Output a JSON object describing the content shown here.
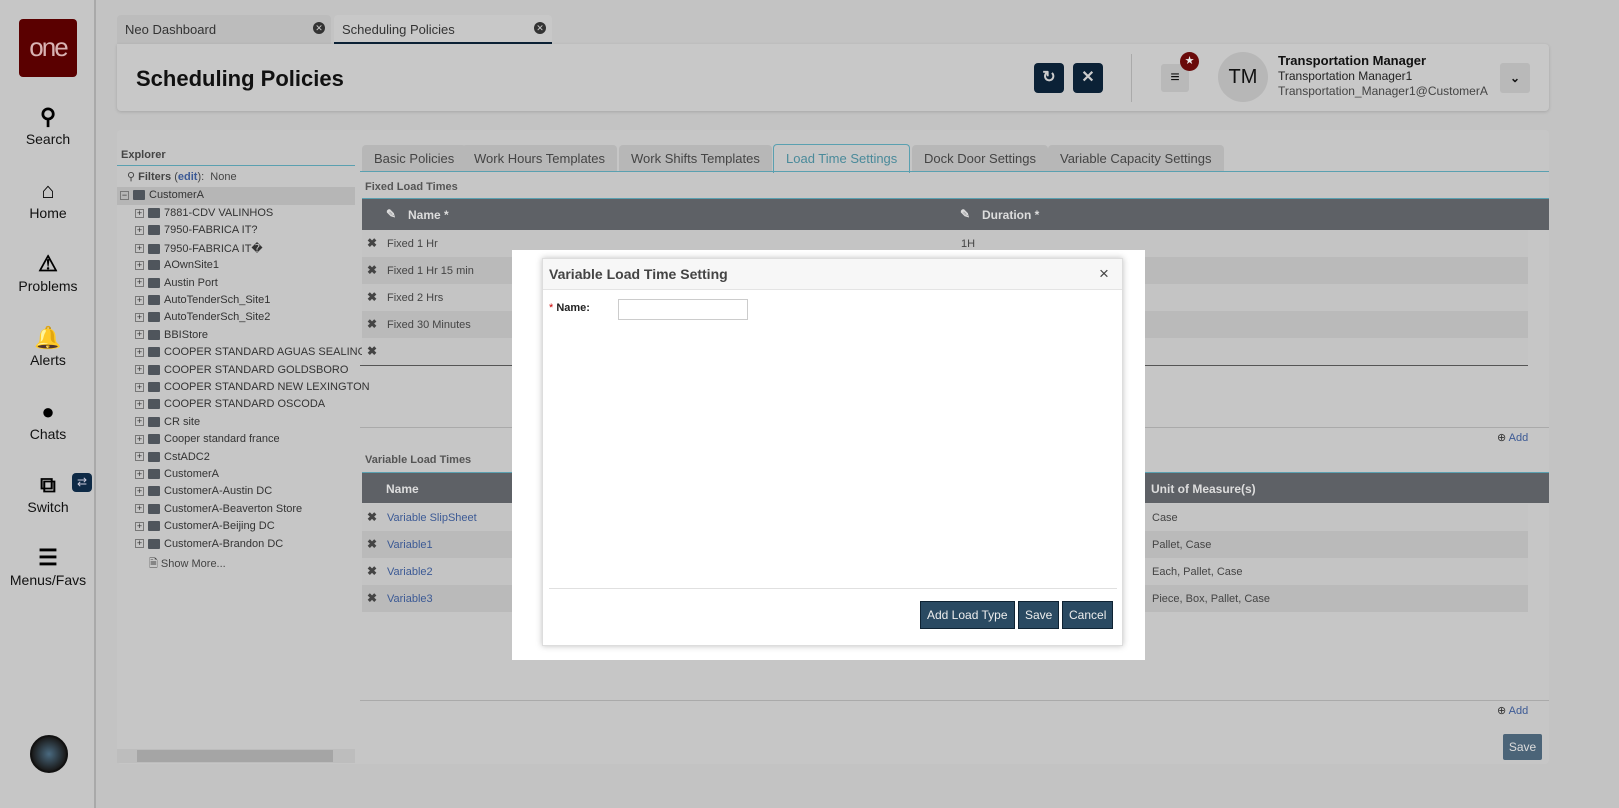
{
  "logo": "one",
  "nav": [
    {
      "label": "Search",
      "icon": "search-icon"
    },
    {
      "label": "Home",
      "icon": "home-icon"
    },
    {
      "label": "Problems",
      "icon": "warning-icon"
    },
    {
      "label": "Alerts",
      "icon": "bell-icon"
    },
    {
      "label": "Chats",
      "icon": "chat-icon"
    },
    {
      "label": "Switch",
      "icon": "switch-icon"
    },
    {
      "label": "Menus/Favs",
      "icon": "menu-icon"
    }
  ],
  "tabs": [
    {
      "label": "Neo Dashboard"
    },
    {
      "label": "Scheduling Policies"
    }
  ],
  "header": {
    "title": "Scheduling Policies",
    "avatar": "TM",
    "user_name": "Transportation Manager",
    "user_role": "Transportation Manager1",
    "user_email": "Transportation_Manager1@CustomerA"
  },
  "explorer": {
    "title": "Explorer",
    "filters_label": "Filters",
    "filters_edit": "edit",
    "filters_value": "None",
    "root": "CustomerA",
    "items": [
      "7881-CDV VALINHOS",
      "7950-FABRICA IT?",
      "7950-FABRICA IT�",
      "AOwnSite1",
      "Austin Port",
      "AutoTenderSch_Site1",
      "AutoTenderSch_Site2",
      "BBIStore",
      "COOPER STANDARD AGUAS SEALING (",
      "COOPER STANDARD GOLDSBORO",
      "COOPER STANDARD NEW LEXINGTON",
      "COOPER STANDARD OSCODA",
      "CR site",
      "Cooper standard france",
      "CstADC2",
      "CustomerA",
      "CustomerA-Austin DC",
      "CustomerA-Beaverton Store",
      "CustomerA-Beijing DC",
      "CustomerA-Brandon DC"
    ],
    "show_more": "Show More..."
  },
  "policy_tabs": [
    "Basic Policies",
    "Work Hours Templates",
    "Work Shifts Templates",
    "Load Time Settings",
    "Dock Door Settings",
    "Variable Capacity Settings"
  ],
  "fixed": {
    "title": "Fixed Load Times",
    "col_name": "Name *",
    "col_duration": "Duration *",
    "rows": [
      {
        "name": "Fixed 1 Hr",
        "duration": "1H"
      },
      {
        "name": "Fixed 1 Hr 15 min"
      },
      {
        "name": "Fixed 2 Hrs"
      },
      {
        "name": "Fixed 30 Minutes"
      },
      {
        "name": ""
      }
    ],
    "add": "Add"
  },
  "variable": {
    "title": "Variable Load Times",
    "col_name": "Name",
    "col_uom": "Unit of Measure(s)",
    "rows": [
      {
        "name": "Variable SlipSheet",
        "uom": "Case"
      },
      {
        "name": "Variable1",
        "uom": "Pallet, Case"
      },
      {
        "name": "Variable2",
        "uom": "Each, Pallet, Case"
      },
      {
        "name": "Variable3",
        "uom": "Piece, Box, Pallet, Case"
      }
    ],
    "add": "Add"
  },
  "save": "Save",
  "modal": {
    "title": "Variable Load Time Setting",
    "name_label": "Name:",
    "required": "*",
    "name_value": "",
    "add_load_type": "Add Load Type",
    "save": "Save",
    "cancel": "Cancel"
  }
}
